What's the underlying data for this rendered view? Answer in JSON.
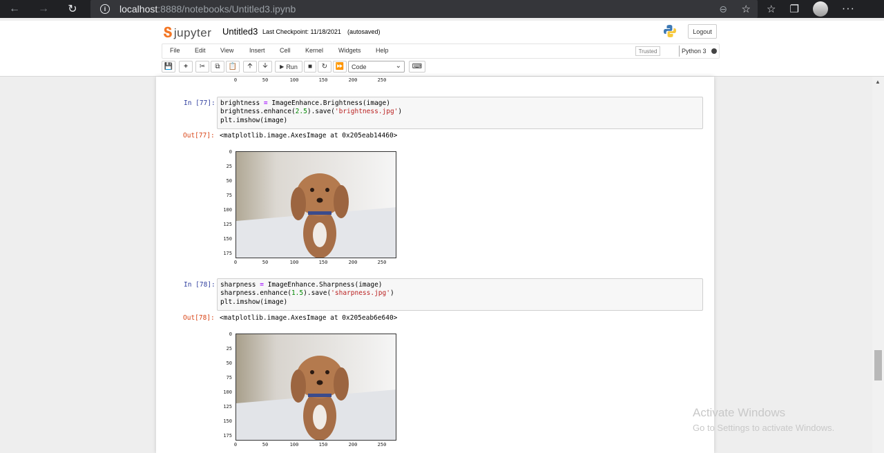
{
  "browser": {
    "url_host": "localhost",
    "url_rest": ":8888/notebooks/Untitled3.ipynb"
  },
  "jupyter": {
    "logo_text": "jupyter",
    "notebook_name": "Untitled3",
    "checkpoint": "Last Checkpoint: 11/18/2021",
    "autosave": "(autosaved)",
    "logout": "Logout",
    "menu": [
      "File",
      "Edit",
      "View",
      "Insert",
      "Cell",
      "Kernel",
      "Widgets",
      "Help"
    ],
    "trusted": "Trusted",
    "kernel": "Python 3",
    "run_label": "Run",
    "cell_type": "Code"
  },
  "cells": [
    {
      "in_prompt": "In [77]:",
      "code": [
        "brightness = ImageEnhance.Brightness(image)",
        "brightness.enhance(2.5).save('brightness.jpg')",
        "plt.imshow(image)"
      ],
      "out_prompt": "Out[77]:",
      "output": "<matplotlib.image.AxesImage at 0x205eab14460>"
    },
    {
      "in_prompt": "In [78]:",
      "code": [
        "sharpness = ImageEnhance.Sharpness(image)",
        "sharpness.enhance(1.5).save('sharpness.jpg')",
        "plt.imshow(image)"
      ],
      "out_prompt": "Out[78]:",
      "output": "<matplotlib.image.AxesImage at 0x205eab6e640>"
    }
  ],
  "plot_axes": {
    "yticks": [
      "0",
      "25",
      "50",
      "75",
      "100",
      "125",
      "150",
      "175"
    ],
    "xticks": [
      "0",
      "50",
      "100",
      "150",
      "200",
      "250"
    ]
  },
  "watermark": {
    "title": "Activate Windows",
    "subtitle": "Go to Settings to activate Windows."
  }
}
